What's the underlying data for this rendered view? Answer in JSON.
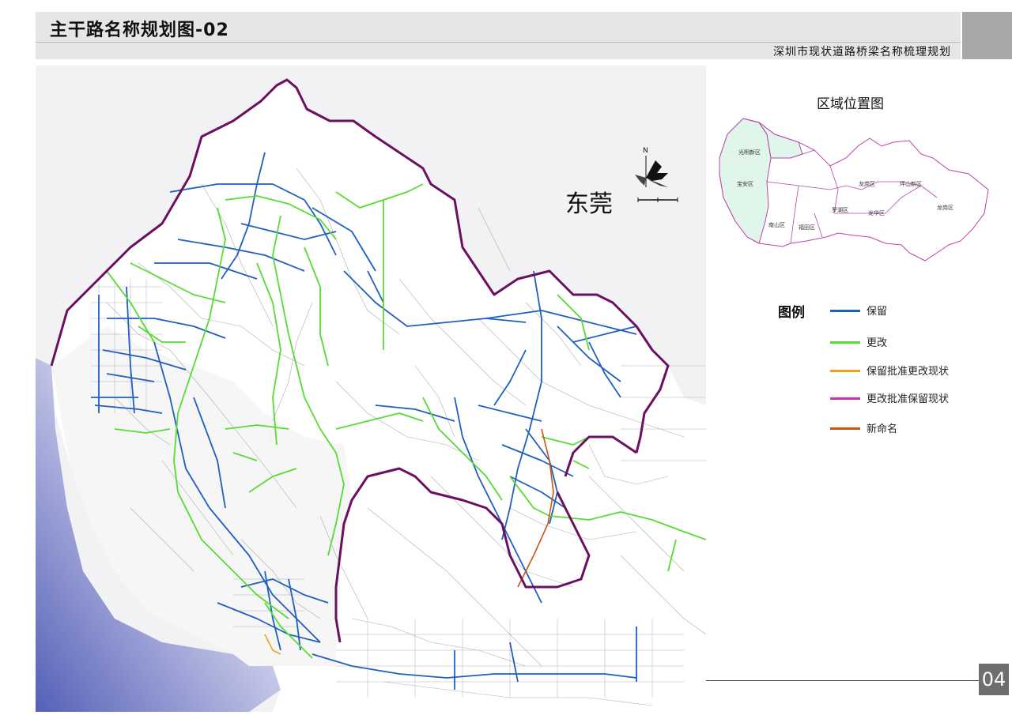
{
  "header": {
    "title": "主干路名称规划图-02",
    "subtitle": "深圳市现状道路桥梁名称梳理规划"
  },
  "map": {
    "neighbor_label": "东莞",
    "north_label": "N",
    "road_colors": {
      "retain": "#1f5fbf",
      "change": "#55dd33",
      "retain_approved": "#f0a020",
      "change_approved": "#cc33aa",
      "new_name": "#cc5511"
    },
    "boundary_color": "#6b1060",
    "sea_color": "#5560b8"
  },
  "locator": {
    "title": "区域位置图",
    "districts": [
      {
        "name": "光明新区"
      },
      {
        "name": "宝安区"
      },
      {
        "name": "龙岗区"
      },
      {
        "name": "坪山新区"
      },
      {
        "name": "龙华区"
      },
      {
        "name": "盐田区"
      },
      {
        "name": "罗湖区"
      },
      {
        "name": "福田区"
      },
      {
        "name": "南山区"
      },
      {
        "name": "龙岗区"
      }
    ]
  },
  "legend": {
    "title": "图例",
    "items": [
      {
        "label": "保留",
        "color": "#1f5fbf"
      },
      {
        "label": "更改",
        "color": "#55dd33"
      },
      {
        "label": "保留批准更改现状",
        "color": "#f0a020"
      },
      {
        "label": "更改批准保留现状",
        "color": "#cc33aa"
      },
      {
        "label": "新命名",
        "color": "#cc5511"
      }
    ]
  },
  "page_number": "04"
}
